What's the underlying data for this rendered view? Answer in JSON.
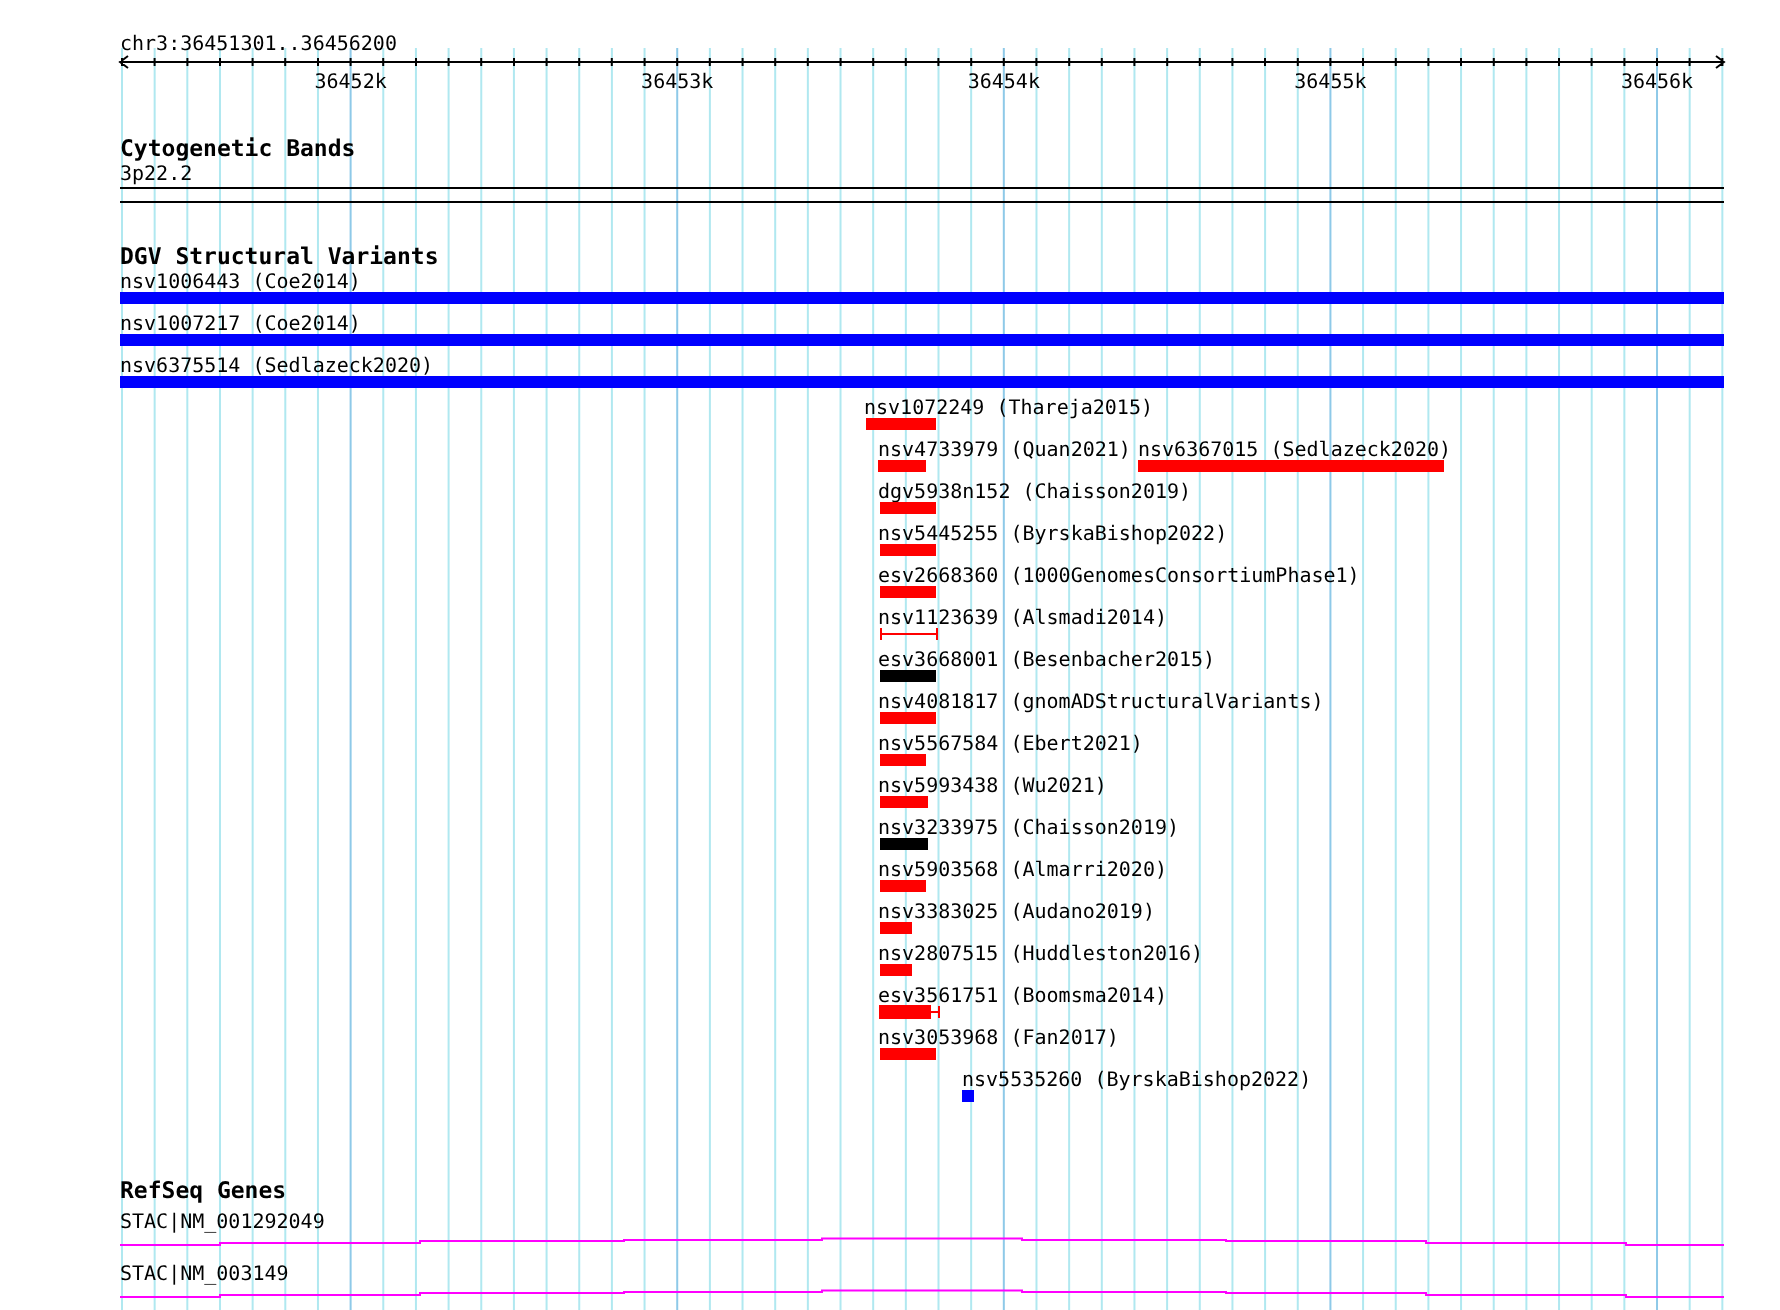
{
  "ruler": {
    "location": "chr3:36451301..36456200",
    "ticks": [
      "36452k",
      "36453k",
      "36454k",
      "36455k",
      "36456k"
    ]
  },
  "tracks": [
    {
      "title": "Cytogenetic Bands",
      "kind": "bands",
      "features": [
        {
          "label": "3p22.2"
        }
      ]
    },
    {
      "title": "DGV Structural Variants",
      "kind": "variants",
      "features": [
        {
          "label": "nsv1006443 (Coe2014)",
          "kind": "bar",
          "color": "#0000ff"
        },
        {
          "label": "nsv1007217 (Coe2014)",
          "kind": "bar",
          "color": "#0000ff"
        },
        {
          "label": "nsv6375514 (Sedlazeck2020)",
          "kind": "bar",
          "color": "#0000ff"
        },
        {
          "label": "nsv1072249 (Thareja2015)",
          "kind": "bar",
          "color": "#ff0000"
        },
        {
          "label": "nsv4733979 (Quan2021)",
          "kind": "bar",
          "color": "#ff0000"
        },
        {
          "label": "nsv6367015 (Sedlazeck2020)",
          "kind": "bar",
          "color": "#ff0000"
        },
        {
          "label": "dgv5938n152 (Chaisson2019)",
          "kind": "bar",
          "color": "#ff0000"
        },
        {
          "label": "nsv5445255 (ByrskaBishop2022)",
          "kind": "bar",
          "color": "#ff0000"
        },
        {
          "label": "esv2668360 (1000GenomesConsortiumPhase1)",
          "kind": "bar",
          "color": "#ff0000"
        },
        {
          "label": "nsv1123639 (Alsmadi2014)",
          "kind": "interval",
          "color": "#ff0000"
        },
        {
          "label": "esv3668001 (Besenbacher2015)",
          "kind": "bar",
          "color": "#000000"
        },
        {
          "label": "nsv4081817 (gnomADStructuralVariants)",
          "kind": "bar",
          "color": "#ff0000"
        },
        {
          "label": "nsv5567584 (Ebert2021)",
          "kind": "bar",
          "color": "#ff0000"
        },
        {
          "label": "nsv5993438 (Wu2021)",
          "kind": "bar",
          "color": "#ff0000"
        },
        {
          "label": "nsv3233975 (Chaisson2019)",
          "kind": "bar",
          "color": "#000000"
        },
        {
          "label": "nsv5903568 (Almarri2020)",
          "kind": "bar",
          "color": "#ff0000"
        },
        {
          "label": "nsv3383025 (Audano2019)",
          "kind": "bar",
          "color": "#ff0000"
        },
        {
          "label": "nsv2807515 (Huddleston2016)",
          "kind": "bar",
          "color": "#ff0000"
        },
        {
          "label": "esv3561751 (Boomsma2014)",
          "kind": "capped",
          "color": "#ff0000"
        },
        {
          "label": "nsv3053968 (Fan2017)",
          "kind": "bar",
          "color": "#ff0000"
        },
        {
          "label": "nsv5535260 (ByrskaBishop2022)",
          "kind": "bar",
          "color": "#0000ff"
        }
      ]
    },
    {
      "title": "RefSeq Genes",
      "kind": "genes",
      "features": [
        {
          "label": "STAC|NM_001292049"
        },
        {
          "label": "STAC|NM_003149"
        }
      ]
    }
  ]
}
